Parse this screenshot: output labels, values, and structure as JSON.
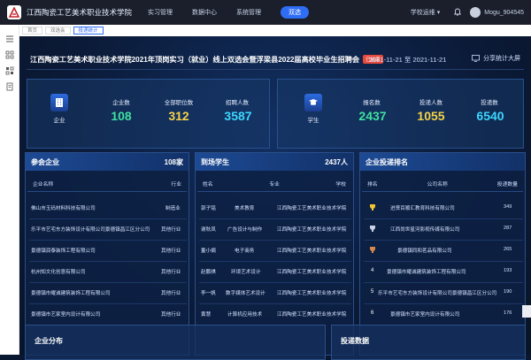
{
  "topbar": {
    "school_name": "江西陶瓷工艺美术职业技术学院",
    "menu": [
      "实习管理",
      "数据中心",
      "系统管理",
      "双选"
    ],
    "role": "学校运维",
    "username": "Mogu_904545"
  },
  "tabs": [
    "首页",
    "双选会",
    "投递统计"
  ],
  "header": {
    "title": "江西陶瓷工艺美术职业技术学院2021年顶岗实习（就业）线上双选会暨浮梁县2022届高校毕业生招聘会",
    "badge": "已结束",
    "dates": "2021-11-21 至 2021-11-21",
    "share_label": "分享统计大屏"
  },
  "stats_enterprise": {
    "icon_label": "企业",
    "items": [
      {
        "label": "企业数",
        "value": "108"
      },
      {
        "label": "全部职位数",
        "value": "312"
      },
      {
        "label": "招聘人数",
        "value": "3587"
      }
    ]
  },
  "stats_student": {
    "icon_label": "学生",
    "items": [
      {
        "label": "报名数",
        "value": "2437"
      },
      {
        "label": "投递人数",
        "value": "1055"
      },
      {
        "label": "投递数",
        "value": "6540"
      }
    ]
  },
  "colors": {
    "green": "#3fe0a0",
    "yellow": "#f4d34a",
    "cyan": "#3cd6ff"
  },
  "panel_companies": {
    "title": "参会企业",
    "count": "108家",
    "cols": [
      "企业名称",
      "行业"
    ],
    "rows": [
      [
        "佛山市玉码材料科技有限公司",
        "制造业"
      ],
      [
        "乐平市艺宅东方装饰设计有限公司景德镇昌江区分公司",
        "其他行业"
      ],
      [
        "景德镇润泰装饰工程有限公司",
        "其他行业"
      ],
      [
        "杭州知文化创意有限公司",
        "其他行业"
      ],
      [
        "景德镇市耀诚建筑装饰工程有限公司",
        "其他行业"
      ],
      [
        "景德镇市艺家室内设计有限公司",
        "其他行业"
      ]
    ]
  },
  "panel_students": {
    "title": "到场学生",
    "count": "2437人",
    "cols": [
      "姓名",
      "专业",
      "学校"
    ],
    "rows": [
      [
        "郭子铭",
        "美术教育",
        "江西陶瓷工艺美术职业技术学院"
      ],
      [
        "谢秋凤",
        "广告设计与制作",
        "江西陶瓷工艺美术职业技术学院"
      ],
      [
        "董小娟",
        "电子商务",
        "江西陶瓷工艺美术职业技术学院"
      ],
      [
        "赵鹏祺",
        "环境艺术设计",
        "江西陶瓷工艺美术职业技术学院"
      ],
      [
        "李一帆",
        "数字媒体艺术设计",
        "江西陶瓷工艺美术职业技术学院"
      ],
      [
        "黄慧",
        "计算机应用技术",
        "江西陶瓷工艺美术职业技术学院"
      ]
    ]
  },
  "panel_ranking": {
    "title": "企业投递排名",
    "cols": [
      "排名",
      "公司名称",
      "投递数量"
    ],
    "rows": [
      [
        "1",
        "进贤百顺汇教育科技有限公司",
        "349"
      ],
      [
        "2",
        "江西尚世星河影视传媒有限公司",
        "287"
      ],
      [
        "3",
        "景德镇同和茗品有限公司",
        "265"
      ],
      [
        "4",
        "景德镇市耀诚建筑装饰工程有限公司",
        "193"
      ],
      [
        "5",
        "乐平市艺宅东方装饰设计有限公司景德镇昌江区分公司",
        "190"
      ],
      [
        "6",
        "景德镇市艺家室内设计有限公司",
        "176"
      ]
    ]
  },
  "bottom": {
    "left_title": "企业分布",
    "right_title": "投递数据"
  }
}
